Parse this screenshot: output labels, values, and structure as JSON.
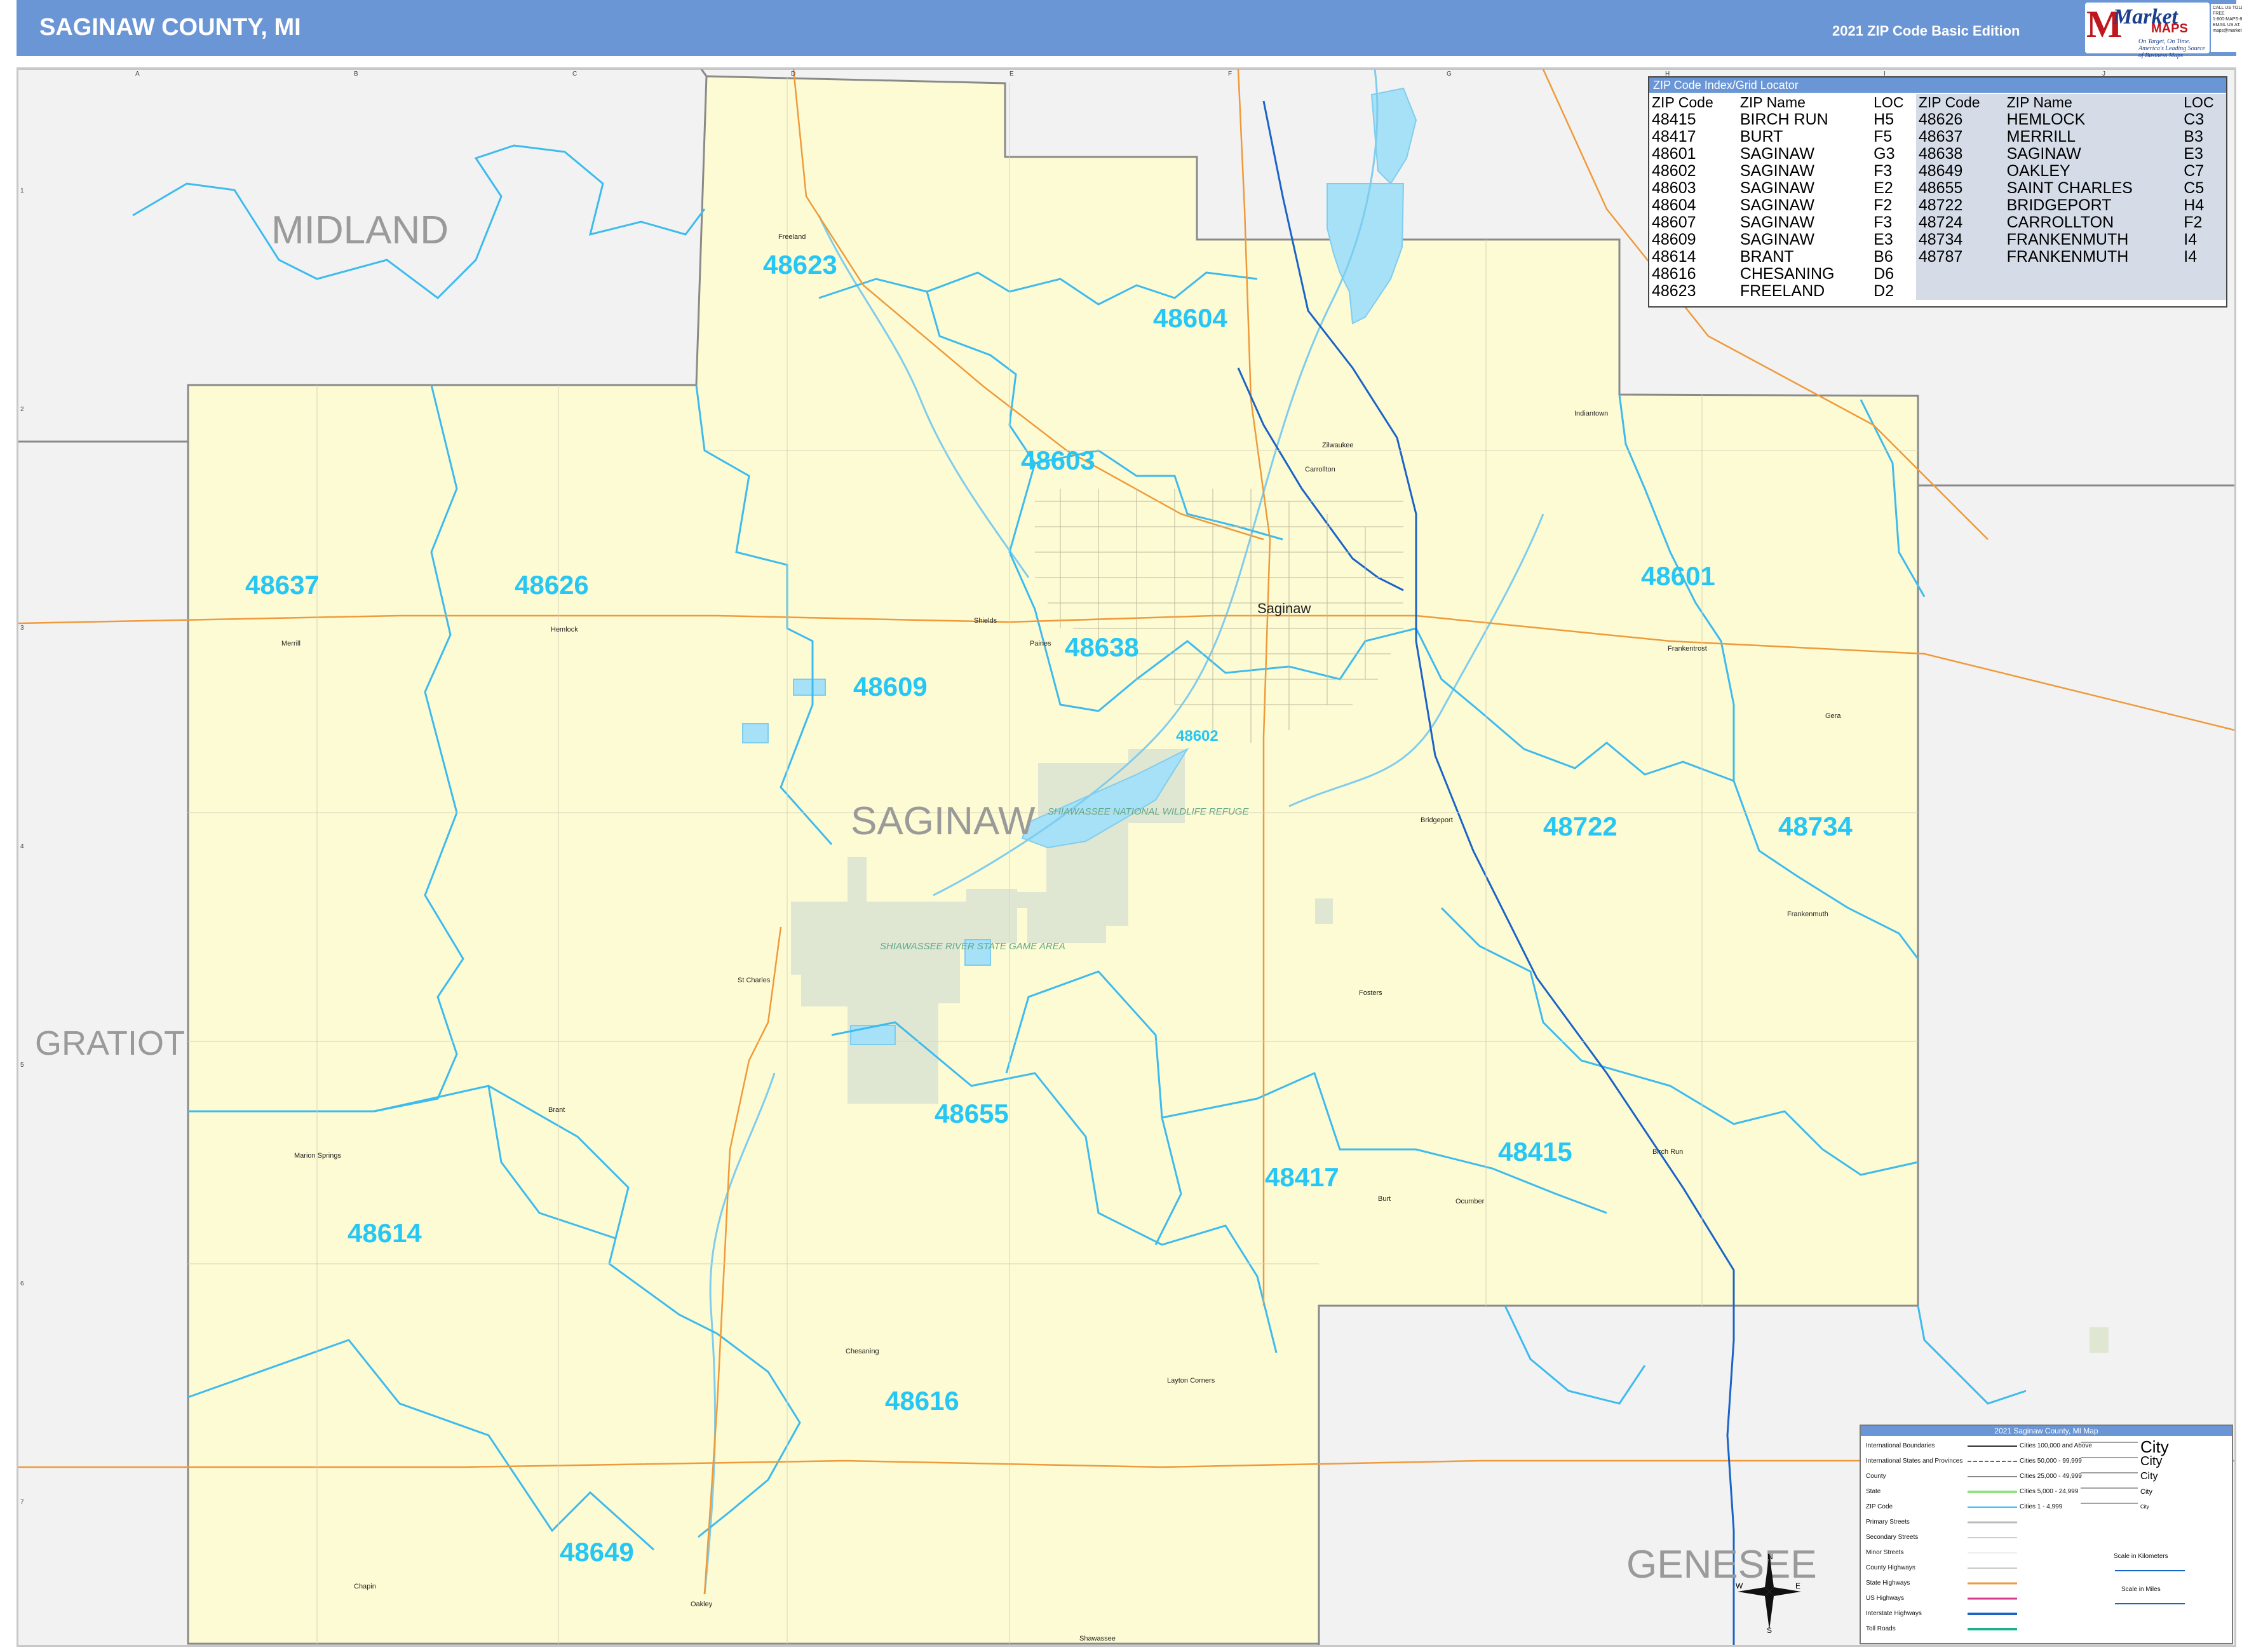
{
  "header": {
    "title": "SAGINAW COUNTY, MI",
    "edition": "2021 ZIP Code Basic Edition",
    "logo": {
      "brand": "Market",
      "brand2": "MAPS",
      "tagline": "On Target, On Time. America's Leading Source of Business Maps"
    },
    "contact": [
      "CALL US TOLL FREE",
      "1-800-MAPS-877",
      "EMAIL US AT:",
      "maps@marketmaps.com"
    ]
  },
  "zip_index": {
    "title": "ZIP Code Index/Grid Locator",
    "columns": [
      "ZIP Code",
      "ZIP Name",
      "LOC"
    ],
    "left": [
      [
        "48415",
        "BIRCH RUN",
        "H5"
      ],
      [
        "48417",
        "BURT",
        "F5"
      ],
      [
        "48601",
        "SAGINAW",
        "G3"
      ],
      [
        "48602",
        "SAGINAW",
        "F3"
      ],
      [
        "48603",
        "SAGINAW",
        "E2"
      ],
      [
        "48604",
        "SAGINAW",
        "F2"
      ],
      [
        "48607",
        "SAGINAW",
        "F3"
      ],
      [
        "48609",
        "SAGINAW",
        "E3"
      ],
      [
        "48614",
        "BRANT",
        "B6"
      ],
      [
        "48616",
        "CHESANING",
        "D6"
      ],
      [
        "48623",
        "FREELAND",
        "D2"
      ]
    ],
    "right": [
      [
        "48626",
        "HEMLOCK",
        "C3"
      ],
      [
        "48637",
        "MERRILL",
        "B3"
      ],
      [
        "48638",
        "SAGINAW",
        "E3"
      ],
      [
        "48649",
        "OAKLEY",
        "C7"
      ],
      [
        "48655",
        "SAINT CHARLES",
        "C5"
      ],
      [
        "48722",
        "BRIDGEPORT",
        "H4"
      ],
      [
        "48724",
        "CARROLLTON",
        "F2"
      ],
      [
        "48734",
        "FRANKENMUTH",
        "I4"
      ],
      [
        "48787",
        "FRANKENMUTH",
        "I4"
      ]
    ]
  },
  "map": {
    "counties": [
      "MIDLAND",
      "SAGINAW",
      "GRATIOT",
      "GENESEE"
    ],
    "zip_labels": [
      "48623",
      "48604",
      "48603",
      "48637",
      "48626",
      "48601",
      "48638",
      "48609",
      "48602",
      "48722",
      "48734",
      "48655",
      "48417",
      "48415",
      "48614",
      "48616",
      "48649"
    ],
    "places": [
      "Freeland",
      "Saginaw",
      "Shields",
      "Paines",
      "Merrill",
      "Hemlock",
      "Zilwaukee",
      "Carrollton",
      "Indiantown",
      "Frankentrost",
      "Gera",
      "Bridgeport",
      "Frankenmuth",
      "St Charles",
      "Fosters",
      "Birch Run",
      "Burt",
      "Brant",
      "Marion Springs",
      "Chesaning",
      "Oakley",
      "Layton Corners",
      "Chapin",
      "Shawassee",
      "Ocumber"
    ],
    "parks": [
      "SHIAWASSEE NATIONAL WILDLIFE REFUGE",
      "SHIAWASSEE RIVER STATE GAME AREA"
    ],
    "grid_cols": [
      "A",
      "B",
      "C",
      "D",
      "E",
      "F",
      "G",
      "H",
      "I",
      "J"
    ],
    "grid_rows": [
      "1",
      "2",
      "3",
      "4",
      "5",
      "6",
      "7"
    ],
    "colors": {
      "county_fill": "#fdfbd3",
      "outside_fill": "#f2f2f2",
      "zip_boundary": "#3dbbee",
      "water": "#a6e1f7",
      "park": "#dfe7d3",
      "interstate": "#1a64c8",
      "highway": "#ef9a3a",
      "header": "#6b96d6"
    }
  },
  "legend": {
    "title": "2021 Saginaw County, MI Map",
    "items": [
      "International Boundaries",
      "International States and Provinces",
      "County",
      "State",
      "ZIP Code",
      "Primary Streets",
      "Secondary Streets",
      "Minor Streets",
      "County Highways",
      "State Highways",
      "US Highways",
      "Interstate Highways",
      "Toll Roads"
    ],
    "cities": [
      {
        "label": "Cities 100,000 and Above",
        "sample": "City"
      },
      {
        "label": "Cities 50,000 - 99,999",
        "sample": "City"
      },
      {
        "label": "Cities 25,000 - 49,999",
        "sample": "City"
      },
      {
        "label": "Cities 5,000 - 24,999",
        "sample": "City"
      },
      {
        "label": "Cities 1 - 4,999",
        "sample": "City"
      }
    ],
    "scale_km": "Scale in Kilometers",
    "scale_mi": "Scale in Miles"
  },
  "compass": {
    "n": "N",
    "s": "S",
    "e": "E",
    "w": "W"
  }
}
